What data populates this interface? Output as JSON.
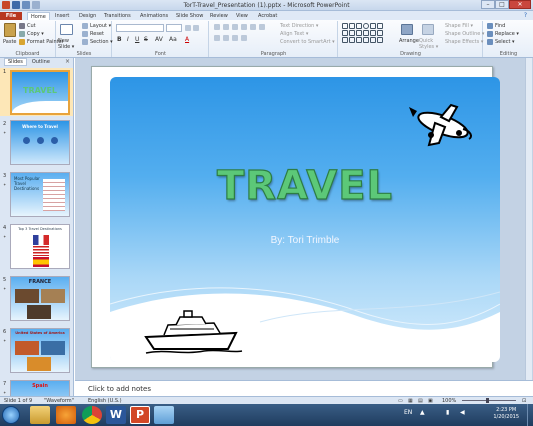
{
  "window": {
    "title": "TorT-Travel_Presentation (1).pptx - Microsoft PowerPoint"
  },
  "tabs": [
    "File",
    "Home",
    "Insert",
    "Design",
    "Transitions",
    "Animations",
    "Slide Show",
    "Review",
    "View",
    "Acrobat"
  ],
  "ribbon": {
    "clipboard": {
      "paste": "Paste",
      "cut": "Cut",
      "copy": "Copy ▾",
      "format_painter": "Format Painter",
      "label": "Clipboard"
    },
    "slides": {
      "new_slide": "New Slide ▾",
      "layout": "Layout ▾",
      "reset": "Reset",
      "section": "Section ▾",
      "label": "Slides"
    },
    "font": {
      "label": "Font"
    },
    "paragraph": {
      "text_direction": "Text Direction ▾",
      "align_text": "Align Text ▾",
      "convert_smartart": "Convert to SmartArt ▾",
      "label": "Paragraph"
    },
    "drawing": {
      "arrange": "Arrange",
      "quick_styles": "Quick Styles ▾",
      "shape_fill": "Shape Fill ▾",
      "shape_outline": "Shape Outline ▾",
      "shape_effects": "Shape Effects ▾",
      "label": "Drawing"
    },
    "editing": {
      "find": "Find",
      "replace": "Replace ▾",
      "select": "Select ▾",
      "label": "Editing"
    }
  },
  "panel": {
    "tab_slides": "Slides",
    "tab_outline": "Outline",
    "close": "×"
  },
  "thumbnails": [
    {
      "num": "1",
      "title": "TRAVEL"
    },
    {
      "num": "2",
      "title": "Where to Travel"
    },
    {
      "num": "3",
      "title": "Most Popular Travel Destinations"
    },
    {
      "num": "4",
      "title": "Top 3 Travel Destinations"
    },
    {
      "num": "5",
      "title": "FRANCE"
    },
    {
      "num": "6",
      "title": "United States of America"
    },
    {
      "num": "7",
      "title": "Spain"
    }
  ],
  "slide": {
    "title": "TRAVEL",
    "subtitle": "By: Tori Trimble"
  },
  "notes": {
    "placeholder": "Click to add notes"
  },
  "status": {
    "slide": "Slide 1 of 9",
    "theme": "\"Waveform\"",
    "language": "English (U.S.)",
    "zoom": "100%"
  },
  "taskbar": {
    "lang": "EN",
    "time": "2:23 PM",
    "date": "1/20/2015"
  }
}
